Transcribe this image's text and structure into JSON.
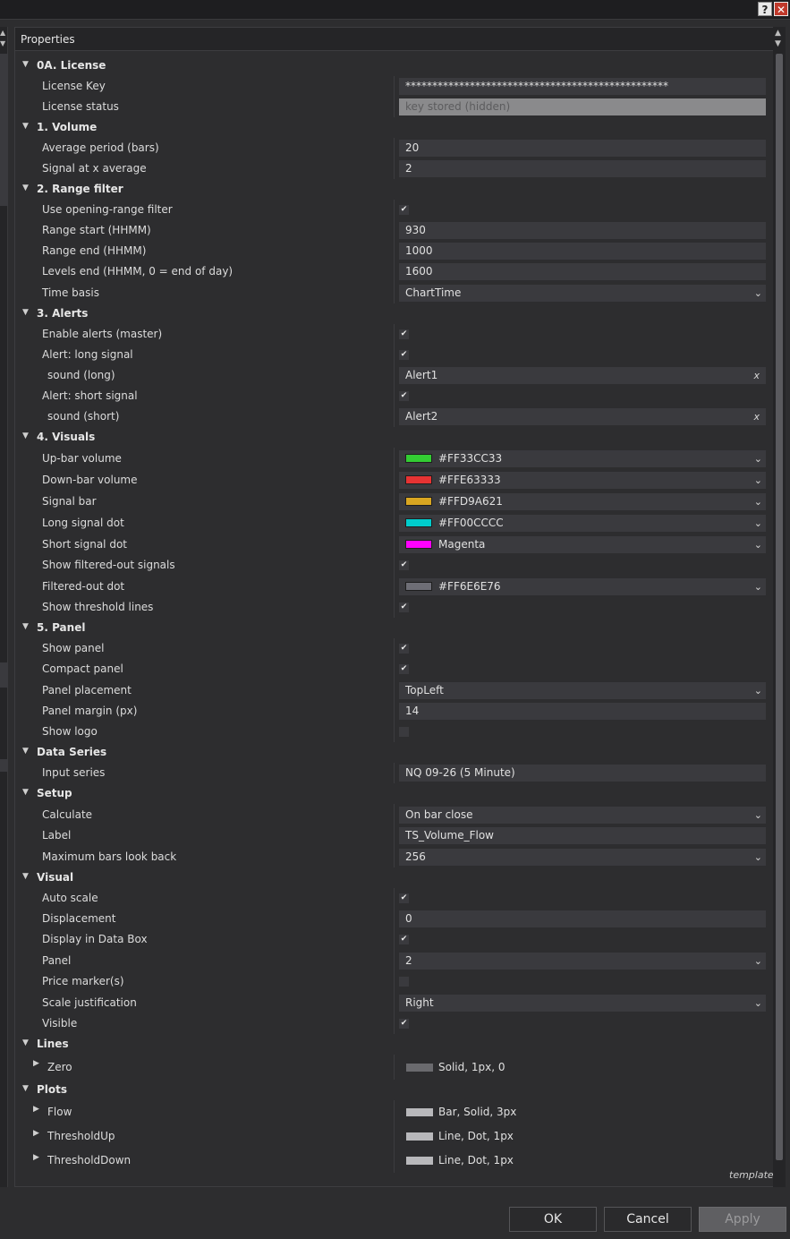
{
  "window": {
    "help_label": "?",
    "close_label": "✕"
  },
  "grid": {
    "header": "Properties",
    "footer": "template"
  },
  "sections": [
    {
      "title": "0A. License",
      "rows": [
        {
          "label": "License Key",
          "type": "text",
          "value": "*************************************************"
        },
        {
          "label": "License status",
          "type": "readonly",
          "value": "key stored (hidden)"
        }
      ]
    },
    {
      "title": "1. Volume",
      "rows": [
        {
          "label": "Average period (bars)",
          "type": "text",
          "value": "20"
        },
        {
          "label": "Signal at x average",
          "type": "text",
          "value": "2"
        }
      ]
    },
    {
      "title": "2. Range filter",
      "rows": [
        {
          "label": "Use opening-range filter",
          "type": "check",
          "checked": true
        },
        {
          "label": "Range start (HHMM)",
          "type": "text",
          "value": "930"
        },
        {
          "label": "Range end (HHMM)",
          "type": "text",
          "value": "1000"
        },
        {
          "label": "Levels end (HHMM, 0 = end of day)",
          "type": "text",
          "value": "1600"
        },
        {
          "label": "Time basis",
          "type": "select",
          "value": "ChartTime"
        }
      ]
    },
    {
      "title": "3. Alerts",
      "rows": [
        {
          "label": "Enable alerts (master)",
          "type": "check",
          "checked": true
        },
        {
          "label": "Alert: long signal",
          "type": "check",
          "checked": true
        },
        {
          "label": "sound (long)",
          "type": "sound",
          "value": "Alert1",
          "sub": true
        },
        {
          "label": "Alert: short signal",
          "type": "check",
          "checked": true
        },
        {
          "label": "sound (short)",
          "type": "sound",
          "value": "Alert2",
          "sub": true
        }
      ]
    },
    {
      "title": "4. Visuals",
      "rows": [
        {
          "label": "Up-bar volume",
          "type": "color",
          "value": "#FF33CC33",
          "swatch": "#33cc33"
        },
        {
          "label": "Down-bar volume",
          "type": "color",
          "value": "#FFE63333",
          "swatch": "#e63333"
        },
        {
          "label": "Signal bar",
          "type": "color",
          "value": "#FFD9A621",
          "swatch": "#d9a621"
        },
        {
          "label": "Long signal dot",
          "type": "color",
          "value": "#FF00CCCC",
          "swatch": "#00cccc"
        },
        {
          "label": "Short signal dot",
          "type": "color",
          "value": "Magenta",
          "swatch": "#ff00ff"
        },
        {
          "label": "Show filtered-out signals",
          "type": "check",
          "checked": true
        },
        {
          "label": "Filtered-out dot",
          "type": "color",
          "value": "#FF6E6E76",
          "swatch": "#6e6e76"
        },
        {
          "label": "Show threshold lines",
          "type": "check",
          "checked": true
        }
      ]
    },
    {
      "title": "5. Panel",
      "rows": [
        {
          "label": "Show panel",
          "type": "check",
          "checked": true
        },
        {
          "label": "Compact panel",
          "type": "check",
          "checked": true
        },
        {
          "label": "Panel placement",
          "type": "select",
          "value": "TopLeft"
        },
        {
          "label": "Panel margin (px)",
          "type": "text",
          "value": "14"
        },
        {
          "label": "Show logo",
          "type": "check",
          "checked": false
        }
      ]
    },
    {
      "title": "Data Series",
      "rows": [
        {
          "label": "Input series",
          "type": "text",
          "value": "NQ 09-26 (5 Minute)"
        }
      ]
    },
    {
      "title": "Setup",
      "rows": [
        {
          "label": "Calculate",
          "type": "select",
          "value": "On bar close"
        },
        {
          "label": "Label",
          "type": "text",
          "value": "TS_Volume_Flow"
        },
        {
          "label": "Maximum bars look back",
          "type": "select",
          "value": "256"
        }
      ]
    },
    {
      "title": "Visual",
      "rows": [
        {
          "label": "Auto scale",
          "type": "check",
          "checked": true
        },
        {
          "label": "Displacement",
          "type": "text",
          "value": "0"
        },
        {
          "label": "Display in Data Box",
          "type": "check",
          "checked": true
        },
        {
          "label": "Panel",
          "type": "select",
          "value": "2"
        },
        {
          "label": "Price marker(s)",
          "type": "check",
          "checked": false
        },
        {
          "label": "Scale justification",
          "type": "select",
          "value": "Right"
        },
        {
          "label": "Visible",
          "type": "check",
          "checked": true
        }
      ]
    },
    {
      "title": "Lines",
      "rows": [
        {
          "label": "Zero",
          "type": "stroke",
          "value": "Solid, 1px, 0",
          "swatch_tone": "dark",
          "expandable": true
        }
      ]
    },
    {
      "title": "Plots",
      "rows": [
        {
          "label": "Flow",
          "type": "stroke",
          "value": "Bar, Solid, 3px",
          "swatch_tone": "light",
          "expandable": true
        },
        {
          "label": "ThresholdUp",
          "type": "stroke",
          "value": "Line, Dot, 1px",
          "swatch_tone": "light",
          "expandable": true
        },
        {
          "label": "ThresholdDown",
          "type": "stroke",
          "value": "Line, Dot, 1px",
          "swatch_tone": "light",
          "expandable": true
        }
      ]
    }
  ],
  "buttons": {
    "ok": "OK",
    "cancel": "Cancel",
    "apply": "Apply"
  }
}
